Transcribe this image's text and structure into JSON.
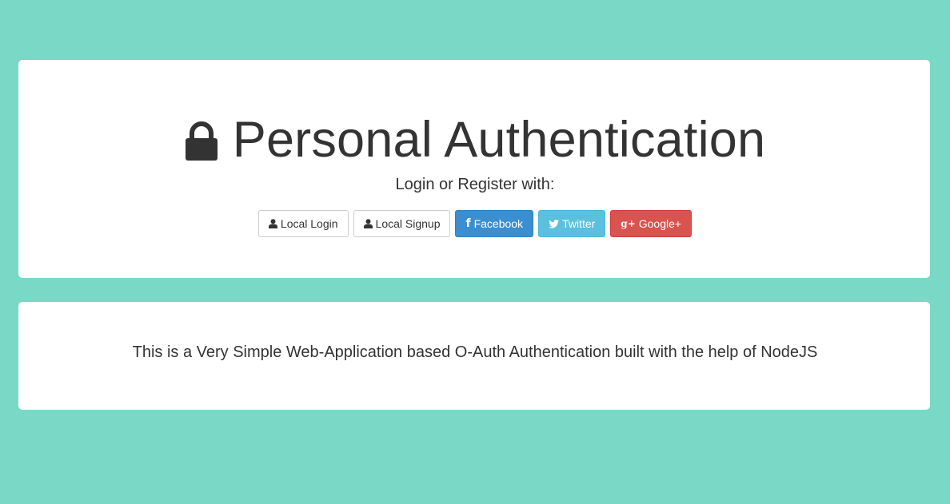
{
  "header": {
    "title": "Personal Authentication",
    "icon": "lock-icon",
    "subtitle": "Login or Register with:"
  },
  "buttons": {
    "local_login": {
      "label": "Local Login",
      "icon": "user-icon"
    },
    "local_signup": {
      "label": "Local Signup",
      "icon": "user-icon"
    },
    "facebook": {
      "label": "Facebook",
      "icon": "facebook-icon",
      "glyph": "f",
      "color": "#3b8ed0"
    },
    "twitter": {
      "label": "Twitter",
      "icon": "twitter-icon",
      "color": "#5bc0de"
    },
    "google": {
      "label": "Google+",
      "icon": "google-plus-icon",
      "glyph": "g+",
      "color": "#d9534f"
    }
  },
  "info": {
    "text": "This is a Very Simple Web-Application based O-Auth Authentication built with the help of NodeJS"
  },
  "colors": {
    "background": "#79d8c6",
    "panel": "#ffffff",
    "text": "#333333"
  }
}
